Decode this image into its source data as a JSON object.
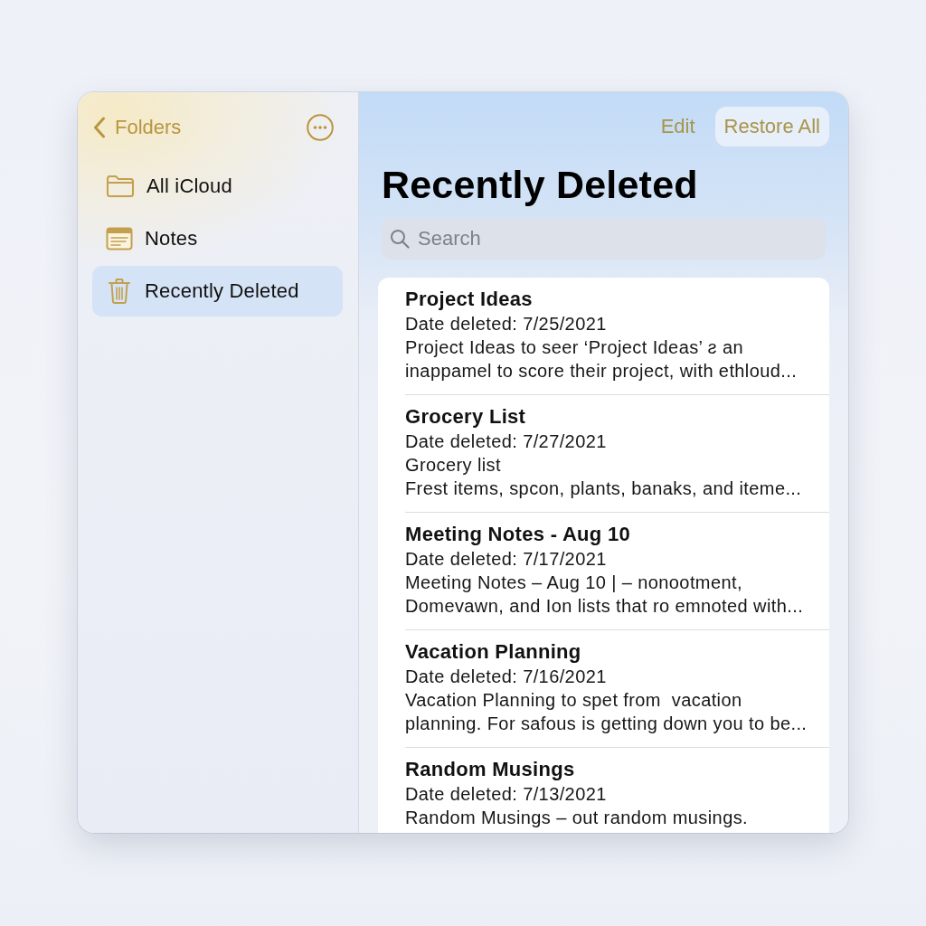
{
  "sidebar": {
    "back_button": {
      "label": "Folders"
    },
    "items": [
      {
        "label": "All iCloud",
        "selected": false
      },
      {
        "label": "Notes",
        "selected": false
      },
      {
        "label": "Recently Deleted",
        "selected": true
      }
    ]
  },
  "toolbar": {
    "buttons": [
      {
        "label": "Edit",
        "kind": "plain"
      },
      {
        "label": "Restore All",
        "kind": "filled"
      }
    ]
  },
  "title": "Recently Deleted",
  "search": {
    "placeholder": "Search"
  },
  "notes": [
    {
      "title": "Project Ideas",
      "date": "Date deleted: 7/25/2021",
      "preview": [
        "Project Ideas to seer ‘Project Ideas’ ƨ an",
        "inappamel to score their project, with ethloud..."
      ]
    },
    {
      "title": "Grocery List",
      "date": "Date deleted: 7/27/2021",
      "preview": [
        "Grocery list",
        "Frest items, spcon, plants, banaks, and iteme..."
      ]
    },
    {
      "title": "Meeting Notes - Aug 10",
      "date": "Date deleted: 7/17/2021",
      "preview": [
        "Meeting Notes – Aug 10 | – nonootment,",
        "Domevawn, and Ion lists that ro emnoted with..."
      ]
    },
    {
      "title": "Vacation Planning",
      "date": "Date deleted: 7/16/2021",
      "preview": [
        "Vacation Planning to spet from  vacation",
        "planning. For safous is getting down you to be..."
      ]
    },
    {
      "title": "Random Musings",
      "date": "Date deleted: 7/13/2021",
      "preview": [
        "Random Musings – out random musings."
      ]
    }
  ]
}
